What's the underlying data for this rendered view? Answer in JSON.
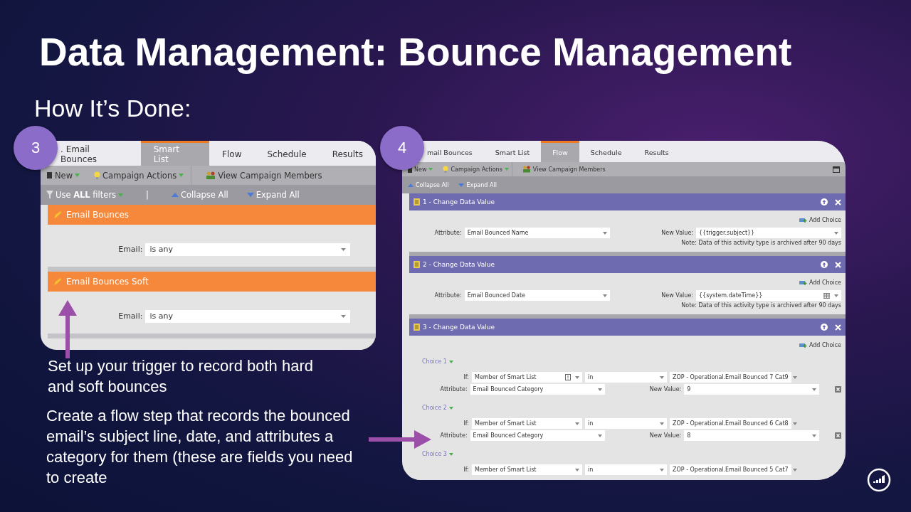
{
  "slide": {
    "title": "Data Management: Bounce Management",
    "subtitle": "How It’s Done:"
  },
  "left_panel": {
    "badge": "3",
    "tabs": [
      {
        "label": ". Email Bounces",
        "selected": false
      },
      {
        "label": "Smart List",
        "selected": true
      },
      {
        "label": "Flow",
        "selected": false
      },
      {
        "label": "Schedule",
        "selected": false
      },
      {
        "label": "Results",
        "selected": false
      }
    ],
    "toolbar": [
      "New",
      "Campaign Actions",
      "View Campaign Members"
    ],
    "filter_mode": "Use **ALL** filters",
    "divider": "|",
    "collapse": "Collapse All",
    "expand": "Expand All",
    "filters": [
      {
        "name": "Email Bounces",
        "field_label": "Email:",
        "value": "is any"
      },
      {
        "name": "Email Bounces Soft",
        "field_label": "Email:",
        "value": "is any"
      }
    ]
  },
  "right_panel": {
    "badge": "4",
    "tabs": [
      {
        "label": "mail Bounces",
        "selected": false
      },
      {
        "label": "Smart List",
        "selected": false
      },
      {
        "label": "Flow",
        "selected": true
      },
      {
        "label": "Schedule",
        "selected": false
      },
      {
        "label": "Results",
        "selected": false
      }
    ],
    "toolbar": [
      "New",
      "Campaign Actions",
      "View Campaign Members"
    ],
    "collapse": "Collapse All",
    "expand": "Expand All",
    "steps": [
      {
        "title": "1 - Change Data Value",
        "add_choice": "Add Choice",
        "attribute_label": "Attribute:",
        "attribute": "Email Bounced Name",
        "new_value_label": "New Value:",
        "new_value": "{{trigger.subject}}",
        "calendar": false,
        "note": "Note: Data of this activity type is archived after 90 days"
      },
      {
        "title": "2 - Change Data Value",
        "add_choice": "Add Choice",
        "attribute_label": "Attribute:",
        "attribute": "Email Bounced Date",
        "new_value_label": "New Value:",
        "new_value": "{{system.dateTime}}",
        "calendar": true,
        "note": "Note: Data of this activity type is archived after 90 days"
      },
      {
        "title": "3 - Change Data Value",
        "add_choice": "Add Choice",
        "choices": [
          {
            "label": "Choice 1",
            "if_label": "If:",
            "condition": "Member of Smart List",
            "warning": true,
            "operator": "in",
            "list": "ZOP - Operational.Email Bounced 7 Cat9",
            "attribute_label": "Attribute:",
            "attribute": "Email Bounced Category",
            "new_value_label": "New Value:",
            "new_value": "9"
          },
          {
            "label": "Choice 2",
            "if_label": "If:",
            "condition": "Member of Smart List",
            "warning": false,
            "operator": "in",
            "list": "ZOP - Operational.Email Bounced 6 Cat8",
            "attribute_label": "Attribute:",
            "attribute": "Email Bounced Category",
            "new_value_label": "New Value:",
            "new_value": "8"
          },
          {
            "label": "Choice 3",
            "if_label": "If:",
            "condition": "Member of Smart List",
            "warning": false,
            "operator": "in",
            "list": "ZOP - Operational.Email Bounced 5 Cat7"
          }
        ]
      }
    ]
  },
  "captions": [
    "Set up your trigger to record both hard and soft bounces",
    "Create a flow step that records the bounced email’s subject line, date, and attributes a category for them (these are fields you need to create"
  ]
}
